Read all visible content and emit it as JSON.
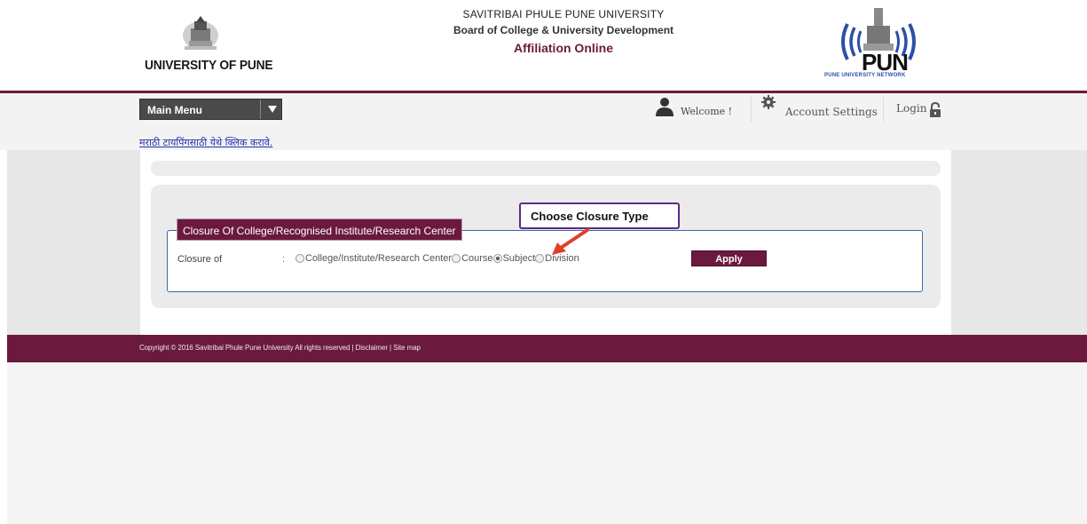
{
  "header": {
    "left_logo_text": "UNIVERSITY OF PUNE",
    "title_line1": "SAVITRIBAI PHULE PUNE UNIVERSITY",
    "title_line2": "Board of College & University Development",
    "title_line3": "Affiliation Online",
    "right_logo_wordmark": "PUN",
    "right_logo_caption": "PUNE UNIVERSITY NETWORK"
  },
  "nav": {
    "main_menu_label": "Main Menu",
    "marathi_link": "मराठी टायपिंगसाठी येथे क्लिक करावे.",
    "welcome_label": "Welcome !",
    "account_settings_label": "Account Settings",
    "login_label": "Login"
  },
  "form": {
    "legend": "Closure Of College/Recognised Institute/Research Center",
    "closure_label": "Closure of",
    "colon": ":",
    "options": [
      {
        "label": "College/Institute/Research Center",
        "checked": false
      },
      {
        "label": "Course",
        "checked": false
      },
      {
        "label": "Subject",
        "checked": true
      },
      {
        "label": "Division",
        "checked": false
      }
    ],
    "apply_label": "Apply"
  },
  "annotation": {
    "callout_text": "Choose Closure Type"
  },
  "footer": {
    "text": "Copyright © 2016 Savitribai Phule Pune University All rights reserved | Disclaimer | Site map"
  },
  "colors": {
    "brand": "#6b1a3e",
    "callout_border": "#5c2a86",
    "arrow": "#e0402a",
    "link": "#2233aa"
  }
}
